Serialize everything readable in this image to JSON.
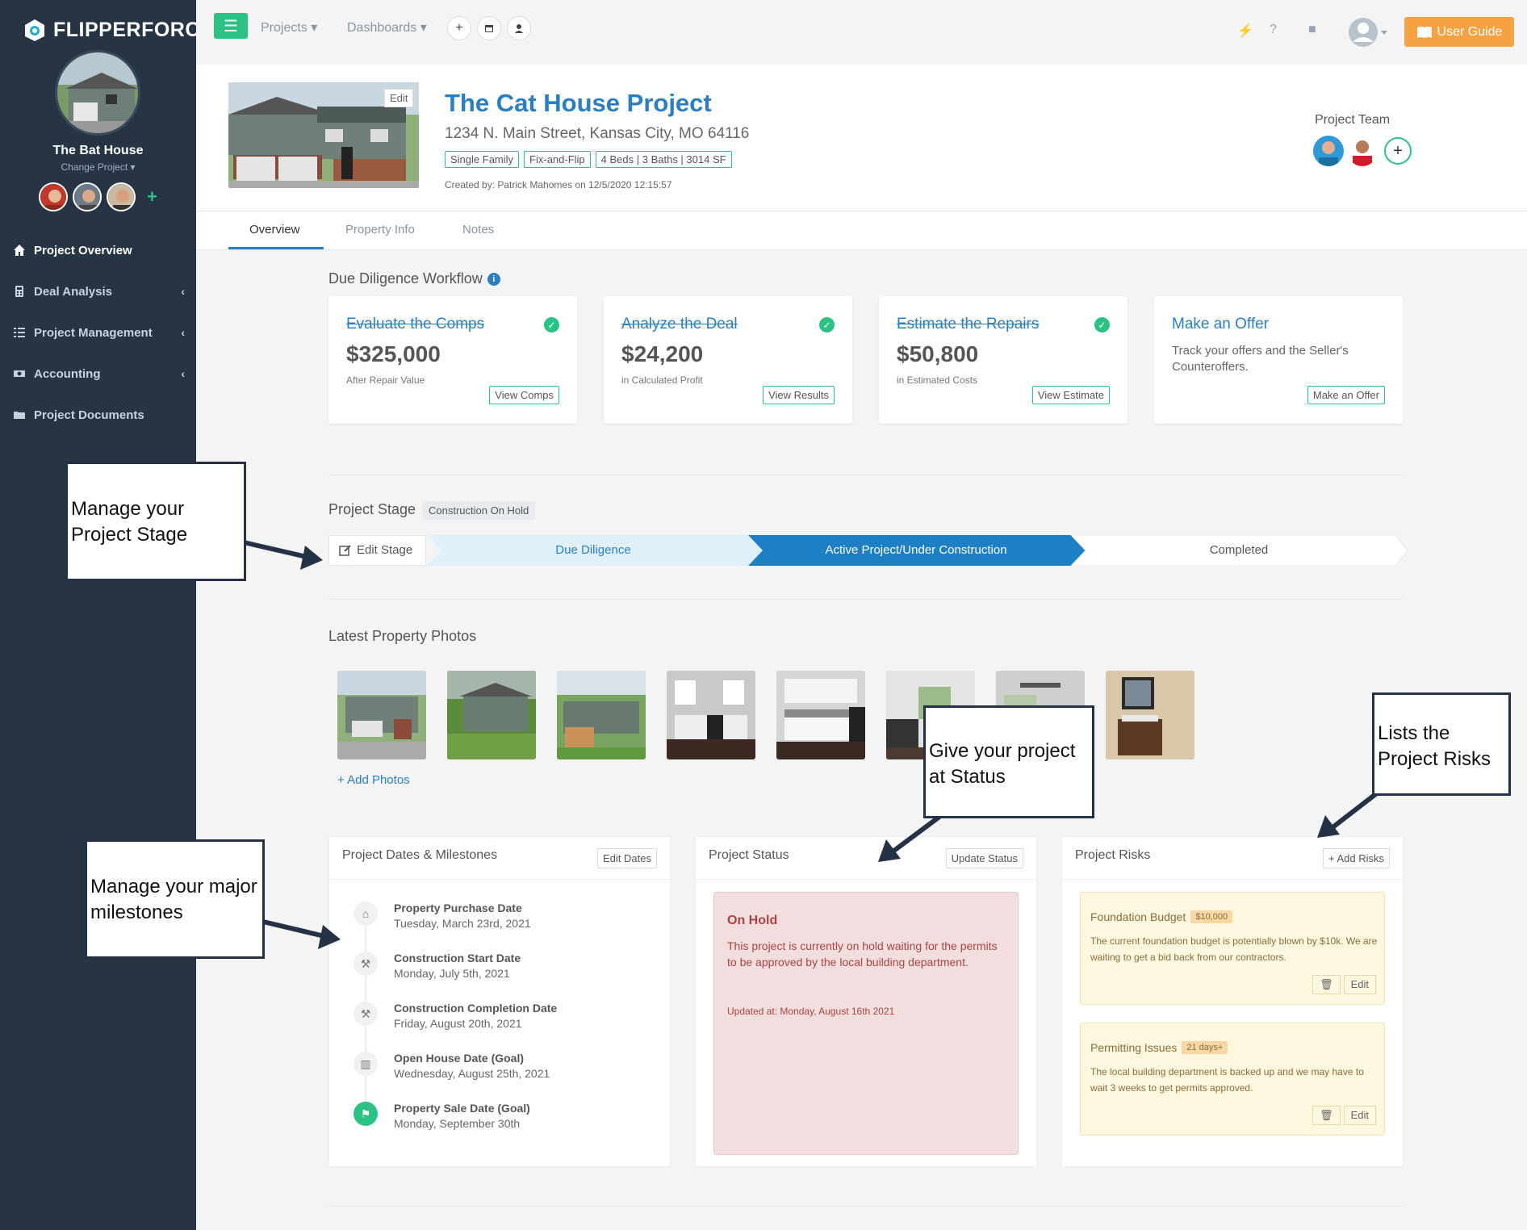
{
  "brand": {
    "name": "FLIPPERFORCE"
  },
  "sidebar": {
    "project_name": "The Bat House",
    "change_project": "Change Project ▾",
    "items": [
      {
        "label": "Project Overview"
      },
      {
        "label": "Deal Analysis"
      },
      {
        "label": "Project Management"
      },
      {
        "label": "Accounting"
      },
      {
        "label": "Project Documents"
      }
    ]
  },
  "topbar": {
    "projects": "Projects ▾",
    "dashboards": "Dashboards ▾",
    "user_guide": "User Guide"
  },
  "header": {
    "edit": "Edit",
    "title": "The Cat House Project",
    "address": "1234 N. Main Street, Kansas City, MO 64116",
    "tags": [
      "Single Family",
      "Fix-and-Flip",
      "4 Beds | 3 Baths | 3014 SF"
    ],
    "created": "Created by: Patrick Mahomes on 12/5/2020 12:15:57",
    "team_label": "Project Team"
  },
  "tabs": [
    "Overview",
    "Property Info",
    "Notes"
  ],
  "workflow": {
    "title": "Due Diligence Workflow",
    "cards": [
      {
        "heading": "Evaluate the Comps",
        "value": "$325,000",
        "sub": "After Repair Value",
        "button": "View Comps"
      },
      {
        "heading": "Analyze the Deal",
        "value": "$24,200",
        "sub": "in Calculated Profit",
        "button": "View Results"
      },
      {
        "heading": "Estimate the Repairs",
        "value": "$50,800",
        "sub": "in Estimated Costs",
        "button": "View Estimate"
      },
      {
        "heading": "Make an Offer",
        "desc": "Track your offers and the Seller's Counteroffers.",
        "button": "Make an Offer"
      }
    ]
  },
  "stage": {
    "title": "Project Stage",
    "badge": "Construction On Hold",
    "edit": "Edit Stage",
    "steps": [
      "Due Diligence",
      "Active Project/Under Construction",
      "Completed"
    ]
  },
  "photos": {
    "title": "Latest Property Photos",
    "add": "+ Add Photos"
  },
  "dates": {
    "title": "Project Dates & Milestones",
    "button": "Edit Dates",
    "items": [
      {
        "title": "Property Purchase Date",
        "date": "Tuesday, March 23rd, 2021"
      },
      {
        "title": "Construction Start Date",
        "date": "Monday, July 5th, 2021"
      },
      {
        "title": "Construction Completion Date",
        "date": "Friday, August 20th, 2021"
      },
      {
        "title": "Open House Date (Goal)",
        "date": "Wednesday, August 25th, 2021"
      },
      {
        "title": "Property Sale Date (Goal)",
        "date": "Monday, September 30th"
      }
    ]
  },
  "status": {
    "title": "Project Status",
    "button": "Update Status",
    "state": "On Hold",
    "text": "This project is currently on hold waiting for the permits to be approved by the local building department.",
    "updated": "Updated at: Monday, August 16th 2021"
  },
  "risks": {
    "title": "Project Risks",
    "button": "+ Add Risks",
    "items": [
      {
        "title": "Foundation Budget",
        "badge": "$10,000",
        "text": "The current foundation budget is potentially blown by $10k. We are waiting to get a bid back from our contractors.",
        "edit": "Edit"
      },
      {
        "title": "Permitting Issues",
        "badge": "21 days+",
        "text": "The local building department is backed up and we may have to wait 3 weeks to get permits approved.",
        "edit": "Edit"
      }
    ]
  },
  "annotations": {
    "stage": "Manage your Project Stage",
    "milestones": "Manage your major milestones",
    "status": "Give your project at Status",
    "risks": "Lists the Project Risks"
  },
  "colors": {
    "sidebar": "#273444",
    "accent_green": "#2cc185",
    "accent_blue": "#2b7fc1",
    "stage_active": "#1d7fc4",
    "user_guide": "#f5a243"
  }
}
